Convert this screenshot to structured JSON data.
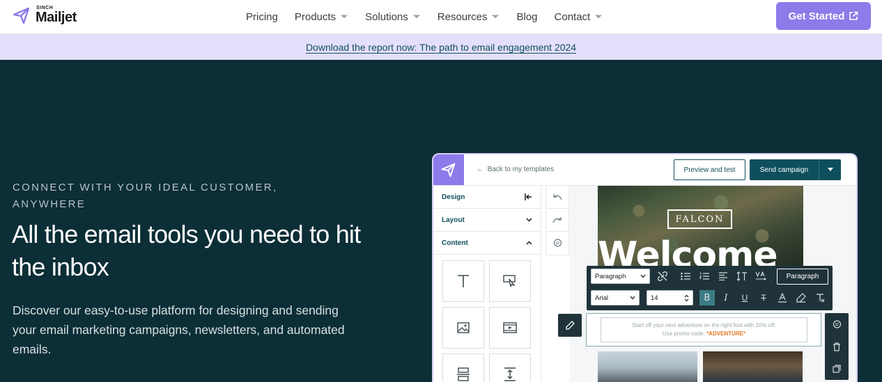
{
  "nav": {
    "logo_top": "SINCH",
    "logo_main": "Mailjet",
    "links": [
      {
        "label": "Pricing",
        "dropdown": false
      },
      {
        "label": "Products",
        "dropdown": true
      },
      {
        "label": "Solutions",
        "dropdown": true
      },
      {
        "label": "Resources",
        "dropdown": true
      },
      {
        "label": "Blog",
        "dropdown": false
      },
      {
        "label": "Contact",
        "dropdown": true
      }
    ],
    "cta_label": "Get Started"
  },
  "banner": {
    "link_text": "Download the report now: The path to email engagement 2024"
  },
  "hero": {
    "eyebrow": "CONNECT WITH YOUR IDEAL CUSTOMER, ANYWHERE",
    "title": "All the email tools you need to hit the inbox",
    "subtitle": "Discover our easy-to-use platform for designing and sending your email marketing campaigns, newsletters, and automated emails."
  },
  "editor": {
    "back_label": "Back to my templates",
    "preview_label": "Preview and test",
    "send_label": "Send campaign",
    "sidebar": {
      "design": "Design",
      "layout": "Layout",
      "content": "Content"
    },
    "brand_text": "FALCON",
    "hero_word": "Welcome",
    "toolbar": {
      "block_type": "Paragraph",
      "font": "Arial",
      "size": "14",
      "right_button": "Paragraph"
    },
    "promo": {
      "line1": "Start off your next adventure on the right foot with 20% off.",
      "line2_prefix": "Use promo code: ",
      "code": "*ADVENTURE*"
    }
  },
  "colors": {
    "brand_purple": "#8c7bea",
    "hero_bg": "#0c2e36",
    "banner_bg": "#e4dffb",
    "teal": "#0f4f5d"
  }
}
